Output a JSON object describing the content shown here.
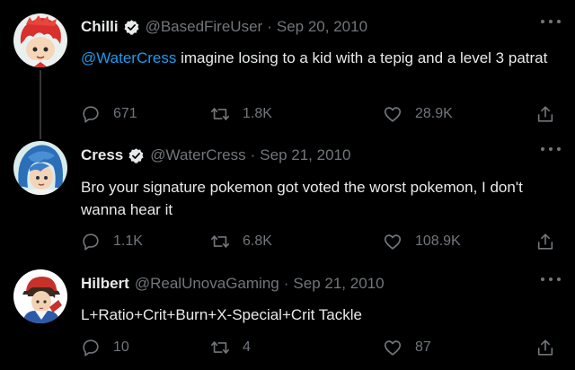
{
  "tweets": [
    {
      "display_name": "Chilli",
      "handle": "@BasedFireUser",
      "separator": "·",
      "date": "Sep 20, 2010",
      "verified": true,
      "mention": "@WaterCress",
      "text": " imagine losing to a kid with a tepig and a level 3 patrat",
      "replies": "671",
      "retweets": "1.8K",
      "likes": "28.9K",
      "avatar_icon": "avatar-chilli"
    },
    {
      "display_name": "Cress",
      "handle": "@WaterCress",
      "separator": "·",
      "date": "Sep 21, 2010",
      "verified": true,
      "mention": "",
      "text": "Bro your signature pokemon got voted the worst pokemon, I don't wanna hear it",
      "replies": "1.1K",
      "retweets": "6.8K",
      "likes": "108.9K",
      "avatar_icon": "avatar-cress"
    },
    {
      "display_name": "Hilbert",
      "handle": "@RealUnovaGaming",
      "separator": "·",
      "date": "Sep 21, 2010",
      "verified": false,
      "mention": "",
      "text": "L+Ratio+Crit+Burn+X-Special+Crit Tackle",
      "replies": "10",
      "retweets": "4",
      "likes": "87",
      "avatar_icon": "avatar-hilbert"
    }
  ],
  "colors": {
    "background": "#000000",
    "text": "#e7e9ea",
    "muted": "#71767b",
    "link": "#1d9bf0",
    "thread_line": "#333639"
  }
}
